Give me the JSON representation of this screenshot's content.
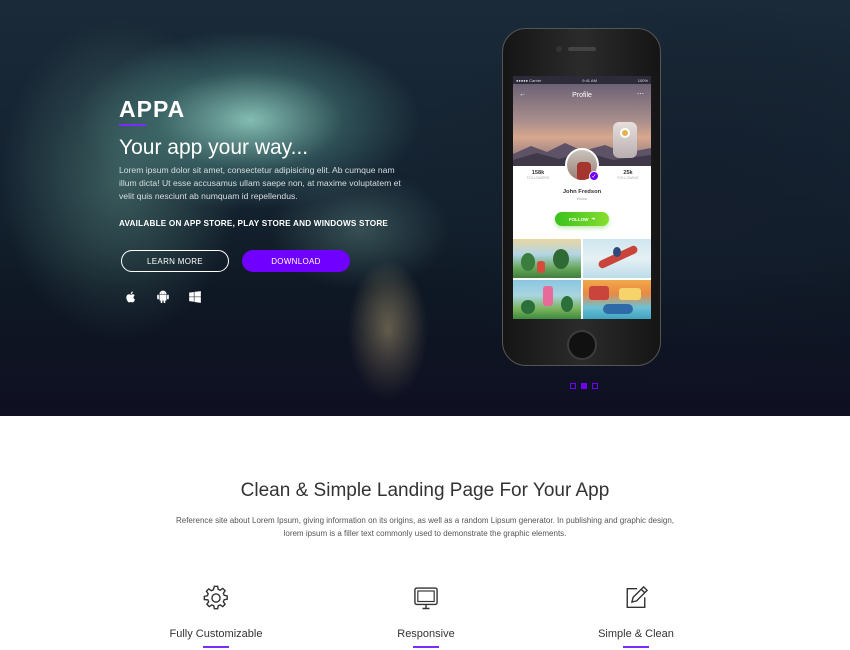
{
  "hero": {
    "brand": "APPA",
    "tagline": "Your app your way...",
    "description": "Lorem ipsum dolor sit amet, consectetur adipisicing elit. Ab cumque nam illum dicta! Ut esse accusamus ullam saepe non, at maxime voluptatem et velit quis nesciunt ab numquam id repellendus.",
    "availability": "AVAILABLE ON APP STORE, PLAY STORE AND WINDOWS STORE",
    "learn_more_label": "LEARN MORE",
    "download_label": "DOWNLOAD",
    "platform_icons": [
      "apple-icon",
      "android-icon",
      "windows-icon"
    ],
    "accent_color": "#7000ff"
  },
  "phone_screen": {
    "status_left": "●●●●● Carrier",
    "status_time": "9:41 AM",
    "status_right": "100%",
    "nav_title": "Profile",
    "nav_back": "←",
    "nav_more": "⋯",
    "followers_count": "158k",
    "followers_caption": "FOLLOWERS",
    "following_count": "25k",
    "following_caption": "FOLLOWING",
    "profile_name": "John Fredson",
    "profile_location": "Widow",
    "follow_label": "FOLLOW",
    "follow_arrow": "➜",
    "verified_mark": "✓"
  },
  "carousel": {
    "total": 3,
    "active_index": 1
  },
  "features_section": {
    "title": "Clean & Simple Landing Page For Your App",
    "description": "Reference site about Lorem Ipsum, giving information on its origins, as well as a random Lipsum generator. In publishing and graphic design, lorem ipsum is a filler text commonly used to demonstrate the graphic elements.",
    "items": [
      {
        "label": "Fully Customizable",
        "icon": "gear-icon"
      },
      {
        "label": "Responsive",
        "icon": "monitor-icon"
      },
      {
        "label": "Simple & Clean",
        "icon": "edit-icon"
      }
    ]
  }
}
